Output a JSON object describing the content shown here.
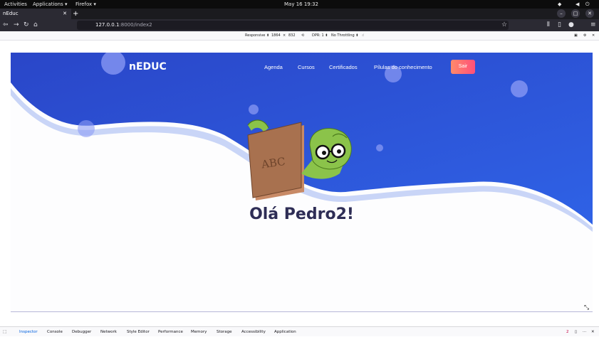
{
  "system_bar": {
    "activities": "Activities",
    "applications": "Applications ▾",
    "firefox": "Firefox ▾",
    "datetime": "May 16  19:32"
  },
  "browser": {
    "tab_title": "nEduc",
    "tab_close": "✕",
    "new_tab": "+",
    "url_host": "127.0.0.1",
    "url_rest": ":8000/index2"
  },
  "rdm": {
    "device": "Responsive ⬍",
    "width": "1864",
    "times": "×",
    "height": "832",
    "dpr": "DPR: 1 ⬍",
    "throttling": "No Throttling ⬍"
  },
  "site": {
    "logo": "nEDUC",
    "nav": [
      "Agenda",
      "Cursos",
      "Certificados",
      "Pílulas do conhecimento"
    ],
    "logout": "Sair",
    "book_text": "ABC",
    "greeting": "Olá Pedro2!"
  },
  "devtools": {
    "tabs": [
      "Inspector",
      "Console",
      "Debugger",
      "Network",
      "Style Editor",
      "Performance",
      "Memory",
      "Storage",
      "Accessibility",
      "Application"
    ],
    "error_count": "2"
  },
  "colors": {
    "hero_blue": "#2f5de0",
    "hero_blue_dark": "#2a46c8",
    "greeting": "#2e2d55",
    "logout_gradient": [
      "#ff8a6a",
      "#ff4f7a"
    ]
  }
}
